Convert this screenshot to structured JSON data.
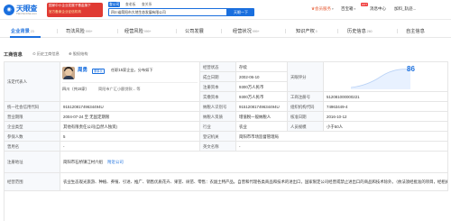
{
  "header": {
    "logo_name": "天眼查",
    "logo_url": "TianYanCha.com",
    "promo_line1": "国家中小企业发展子基金旗下",
    "promo_line2": "官方备案企业征信机构",
    "search_tabs": [
      "查公司",
      "查老板",
      "查关系"
    ],
    "search_value": "四川省简阳市大地生态发展有限公司",
    "search_button": "天眼一下",
    "nav": {
      "vip": "会员服务",
      "app": "百宝箱",
      "hot": "HOT",
      "messages": "消息中心",
      "user": "加料_轨迹..."
    }
  },
  "tabs": [
    {
      "label": "企业背景",
      "count": "23"
    },
    {
      "label": "司法风险",
      "count": "999+"
    },
    {
      "label": "经营风险",
      "count": "999+"
    },
    {
      "label": "公司发展",
      "count": ""
    },
    {
      "label": "经营状况",
      "count": "999+"
    },
    {
      "label": "知识产权",
      "count": "0"
    },
    {
      "label": "历史信息",
      "count": "260"
    },
    {
      "label": "自主信息",
      "count": ""
    }
  ],
  "section": {
    "title": "工商信息",
    "link1": "历史工商信息",
    "link2": "股权结构"
  },
  "legal_rep": {
    "label": "法定代表人",
    "name": "周勇",
    "tag": "董事长",
    "roles": "任职15家企业，分布如下",
    "location": "四川（共15家）",
    "loc_detail": "简阳市广汇小额贷款... 等"
  },
  "fields": {
    "status_label": "经营状态",
    "status_value": "存续",
    "est_label": "成立日期",
    "est_value": "2002-06-10",
    "reg_cap_label": "注册资本",
    "reg_cap_value": "9300万人民币",
    "paid_cap_label": "实缴资本",
    "paid_cap_value": "9300万人民币",
    "score_label": "天眼评分",
    "score_value": "86",
    "credit_code_label": "统一社会信用代码",
    "credit_code_value": "91512081749634494U",
    "tax_id_label": "纳税人识别号",
    "tax_id_value": "91512081749634494U",
    "org_code_label": "组织机构代码",
    "org_code_value": "74963449-4",
    "business_term_label": "营业期限",
    "business_term_value": "2004-07-24 至 无固定期限",
    "taxpayer_label": "纳税人资质",
    "taxpayer_value": "增值税一般纳税人",
    "approval_label": "核准日期",
    "approval_value": "2016-10-12",
    "type_label": "企业类型",
    "type_value": "其他有限责任公司(自然人独资)",
    "industry_label": "行业",
    "industry_value": "农业",
    "staff_label": "人员规模",
    "staff_value": "小于50人",
    "insured_label": "参保人数",
    "insured_value": "5",
    "authority_label": "登记机关",
    "authority_value": "简阳市市场监督管理局",
    "former_label": "曾用名",
    "former_value": "-",
    "en_label": "英文名称",
    "en_value": "-",
    "address_label": "注册地址",
    "address_value": "简阳市石桥镇江村六组",
    "nearby": "附近公司",
    "scope_label": "经营范围",
    "scope_value": "农业生态观光旅游、种植、养殖、引进、推广、销售优质花卉、果苗、树苗、零售：农副土特产品。自营和代理各类商品和技术的进出口，国家限定公司经营或禁止进出口的商品和技术除外。（依法须经批准的项目，经相关部门批准后方可开展经营活动）",
    "reg_no_label": "工商注册号",
    "reg_no_value": "512081000000221"
  },
  "colors": {
    "brand": "#1a6fde",
    "hot": "#f03c3c",
    "promo": "#e03a33",
    "label_bg": "#f7f9fc"
  }
}
